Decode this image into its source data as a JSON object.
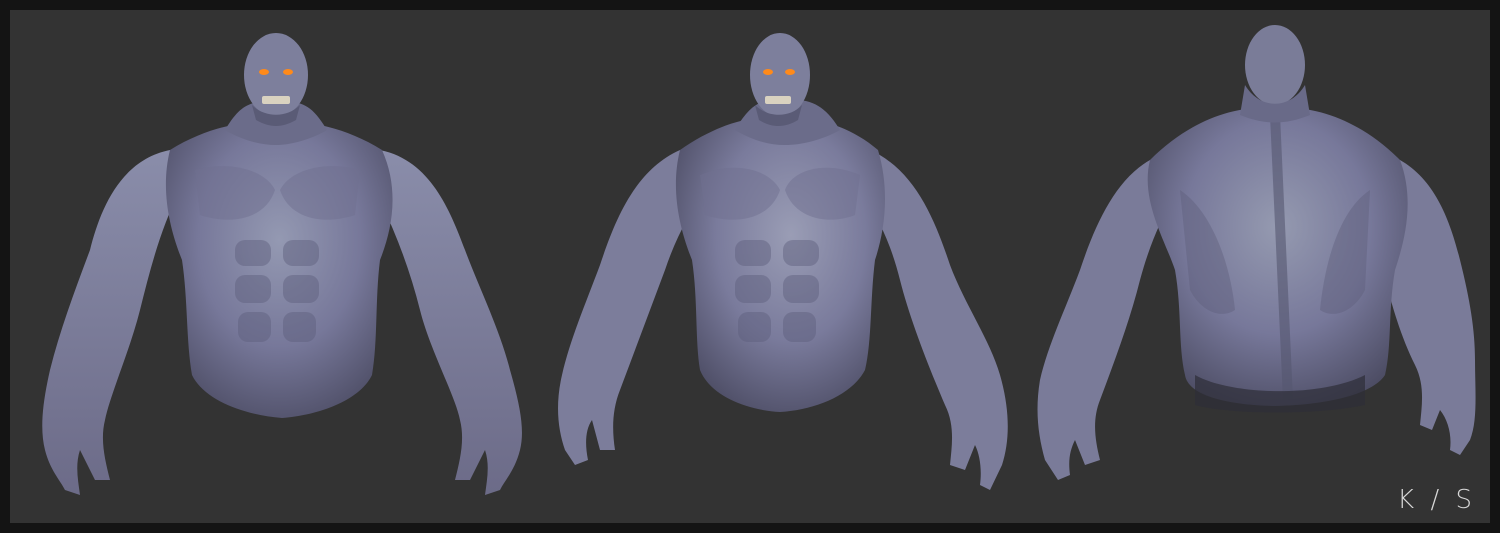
{
  "render": {
    "signature": "K / S",
    "colors": {
      "border": "#141414",
      "background": "#333333",
      "skin": "#7f7f9e",
      "skin_shadow": "#4e4e66",
      "skin_highlight": "#aab0c4",
      "eyes": "#ff8a1a",
      "teeth": "#d9d2c0",
      "signature": "#d8d8d8"
    },
    "views": [
      {
        "name": "front-view"
      },
      {
        "name": "three-quarter-view"
      },
      {
        "name": "back-view"
      }
    ]
  }
}
